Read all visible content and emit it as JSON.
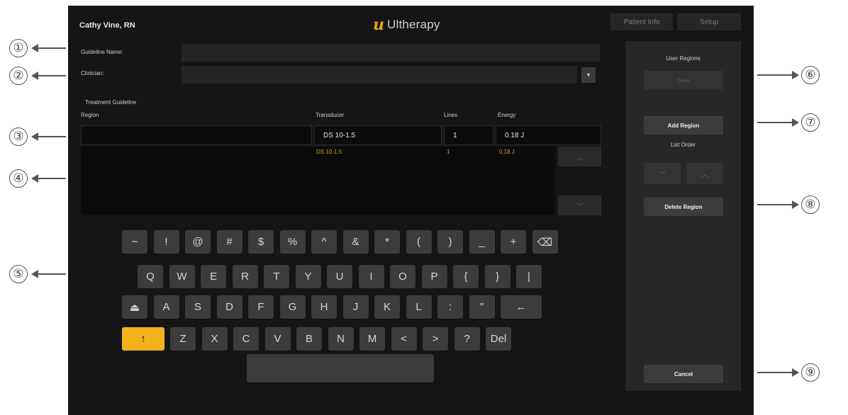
{
  "header": {
    "user": "Cathy Vine, RN",
    "logo_mark": "u",
    "brand": "Ultherapy",
    "tabs": [
      "Patient Info",
      "Setup"
    ]
  },
  "form": {
    "guideline_name_label": "Guideline Name:",
    "guideline_name_value": "",
    "clinician_label": "Clinician:",
    "clinician_value": ""
  },
  "treatment": {
    "section_label": "Treatment Guideline",
    "columns": [
      "Region",
      "Transducer",
      "Lines",
      "Energy"
    ],
    "input_row": {
      "region": "",
      "transducer": "DS 10-1.5",
      "lines": "1",
      "energy": "0.18 J"
    },
    "rows": [
      {
        "region": "",
        "transducer": "DS 10-1.5",
        "lines": "1",
        "energy": "0.18 J"
      }
    ]
  },
  "keyboard": {
    "row1": [
      "~",
      "!",
      "@",
      "#",
      "$",
      "%",
      "^",
      "&",
      "*",
      "(",
      ")",
      "_",
      "+",
      "⌫"
    ],
    "row2": [
      "Q",
      "W",
      "E",
      "R",
      "T",
      "Y",
      "U",
      "I",
      "O",
      "P",
      "{",
      "}",
      "|"
    ],
    "row3": [
      "⏏",
      "A",
      "S",
      "D",
      "F",
      "G",
      "H",
      "J",
      "K",
      "L",
      ":",
      "\"",
      "←"
    ],
    "row4": [
      "↑",
      "Z",
      "X",
      "C",
      "V",
      "B",
      "N",
      "M",
      "<",
      ">",
      "?",
      "Del"
    ]
  },
  "panel": {
    "user_regions_label": "User Regions",
    "save_label": "Save",
    "add_region_label": "Add Region",
    "list_order_label": "List Order",
    "delete_region_label": "Delete Region",
    "cancel_label": "Cancel"
  },
  "callouts": [
    "①",
    "②",
    "③",
    "④",
    "⑤",
    "⑥",
    "⑦",
    "⑧",
    "⑨"
  ],
  "colors": {
    "accent": "#f2b31a",
    "background": "#151515",
    "panel": "#272727",
    "row_text": "#d19a22"
  }
}
